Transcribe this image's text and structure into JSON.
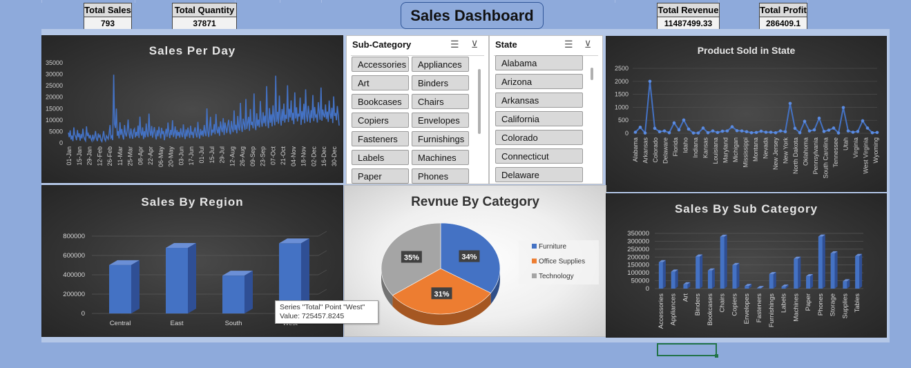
{
  "dashboard": {
    "title": "Sales Dashboard"
  },
  "kpis": {
    "total_sales": {
      "label": "Total Sales",
      "value": "793"
    },
    "total_quantity": {
      "label": "Total Quantity",
      "value": "37871"
    },
    "total_revenue": {
      "label": "Total Revenue",
      "value": "11487499.33"
    },
    "total_profit": {
      "label": "Total Profit",
      "value": "286409.1"
    }
  },
  "slicers": {
    "subcategory": {
      "header": "Sub-Category",
      "items": [
        "Accessories",
        "Appliances",
        "Art",
        "Binders",
        "Bookcases",
        "Chairs",
        "Copiers",
        "Envelopes",
        "Fasteners",
        "Furnishings",
        "Labels",
        "Machines",
        "Paper",
        "Phones"
      ]
    },
    "state": {
      "header": "State",
      "items": [
        "Alabama",
        "Arizona",
        "Arkansas",
        "California",
        "Colorado",
        "Connecticut",
        "Delaware"
      ]
    }
  },
  "tooltip": {
    "line1": "Series \"Total\" Point \"West\"",
    "line2": "Value: 725457.8245"
  },
  "chart_data": [
    {
      "id": "sales-per-day",
      "type": "line",
      "title": "Sales Per Day",
      "color": "#4472c4",
      "ylim": [
        0,
        35000
      ],
      "yticks": [
        "35000",
        "30000",
        "25000",
        "20000",
        "15000",
        "10000",
        "5000",
        "0"
      ],
      "xticks": [
        "01-Jan",
        "15-Jan",
        "29-Jan",
        "12-Feb",
        "26-Feb",
        "11-Mar",
        "25-Mar",
        "08-Apr",
        "22-Apr",
        "06-May",
        "20-May",
        "03-Jun",
        "17-Jun",
        "01-Jul",
        "15-Jul",
        "29-Jul",
        "12-Aug",
        "26-Aug",
        "09-Sep",
        "23-Sep",
        "07-Oct",
        "21-Oct",
        "04-Nov",
        "18-Nov",
        "02-Dec",
        "16-Dec",
        "30-Dec"
      ],
      "values": [
        4500,
        2500,
        5500,
        1500,
        3200,
        800,
        6800,
        3600,
        2800,
        1200,
        5600,
        2500,
        4200,
        1000,
        3800,
        2000,
        6200,
        2800,
        1600,
        900,
        7200,
        3000,
        4000,
        2000,
        3500,
        1800,
        900,
        3600,
        1400,
        2500,
        5200,
        1900,
        800,
        4100,
        2600,
        3300,
        1200,
        600,
        2900,
        5200,
        1800,
        900,
        3100,
        2400,
        1700,
        4200,
        7800,
        2200,
        3000,
        1200,
        29800,
        8200,
        6500,
        15000,
        3100,
        5200,
        2000,
        9000,
        3500,
        6100,
        3000,
        1500,
        7800,
        4200,
        2800,
        5600,
        10200,
        4100,
        2000,
        6300,
        3500,
        1800,
        5500,
        6200,
        2400,
        4800,
        3000,
        7600,
        2200,
        11500,
        4600,
        3200,
        6800,
        1700,
        5200,
        2400,
        8500,
        3900,
        2600,
        12800,
        5200,
        3100,
        7400,
        2300,
        4800,
        6900,
        3400,
        1500,
        5600,
        2900,
        7100,
        4100,
        2000,
        6600,
        3800,
        5200,
        1200,
        3900,
        6200,
        2700,
        8900,
        4500,
        2100,
        5700,
        3400,
        9900,
        2600,
        4200,
        7200,
        1800,
        5600,
        3100,
        4800,
        2300,
        6400,
        3900,
        2500,
        8100,
        3700,
        1700,
        5900,
        2800,
        6700,
        4300,
        2200,
        7500,
        3500,
        4900,
        2100,
        5300,
        6800,
        3600,
        2400,
        9200,
        4100,
        1900,
        6100,
        3300,
        5400,
        2800,
        7800,
        4400,
        3000,
        15100,
        5200,
        2600,
        6900,
        11400,
        3200,
        5800,
        4500,
        8200,
        3800,
        12600,
        5900,
        4200,
        7100,
        3100,
        9400,
        6200,
        4700,
        10800,
        3500,
        8900,
        6600,
        4300,
        7700,
        10100,
        5200,
        3800,
        9600,
        6300,
        4700,
        14200,
        5600,
        7900,
        4200,
        11800,
        6900,
        5400,
        17500,
        7200,
        4800,
        10600,
        8300,
        5700,
        19200,
        6100,
        8700,
        11400,
        5300,
        14800,
        7800,
        9200,
        6400,
        21600,
        8100,
        5600,
        12900,
        7400,
        10200,
        6800,
        18300,
        9600,
        7100,
        13400,
        8600,
        11900,
        7300,
        24800,
        9900,
        6500,
        15200,
        8800,
        12500,
        7200,
        16400,
        10300,
        7700,
        29400,
        9200,
        13600,
        8400,
        20700,
        11200,
        7600,
        14800,
        9700,
        17200,
        8900,
        12300,
        10500,
        25200,
        9100,
        14900,
        11100,
        18600,
        9800,
        13200,
        8200,
        22100,
        10700,
        15600,
        9400,
        12800,
        11600,
        19800,
        7900,
        13900,
        10200,
        17100,
        8600,
        23400,
        11900,
        9300,
        16200,
        12600,
        8800,
        14300,
        10800,
        20900,
        9500,
        15700,
        11400,
        12100,
        8900,
        17800,
        13300,
        10100,
        24200,
        9700,
        14600,
        12200,
        11200,
        16800,
        10400,
        13700,
        9200,
        18500,
        12900,
        10600,
        15400,
        8700,
        20300,
        11800,
        13100,
        9900,
        16100,
        12400,
        7600
      ]
    },
    {
      "id": "product-sold-in-state",
      "type": "line",
      "title": "Product Sold in State",
      "color": "#4472c4",
      "ylim": [
        0,
        2500
      ],
      "yticks": [
        "2500",
        "2000",
        "1500",
        "1000",
        "500",
        "0"
      ],
      "categories": [
        "Alabama",
        "Arkansas",
        "Colorado",
        "Delaware",
        "Florida",
        "Idaho",
        "Indiana",
        "Kansas",
        "Louisiana",
        "Maryland",
        "Michigan",
        "Mississippi",
        "Montana",
        "Nevada",
        "New Jersey",
        "New York",
        "North Dakota",
        "Oklahoma",
        "Pennsylvania",
        "South Carolina",
        "Tennessee",
        "Utah",
        "Virginia",
        "West Virginia",
        "Wyoming"
      ],
      "values": [
        40,
        230,
        10,
        2000,
        190,
        60,
        90,
        20,
        400,
        130,
        510,
        160,
        10,
        10,
        200,
        20,
        90,
        30,
        80,
        90,
        250,
        100,
        90,
        60,
        20,
        30,
        80,
        40,
        40,
        20,
        90,
        60,
        1150,
        190,
        20,
        460,
        90,
        130,
        580,
        70,
        120,
        200,
        10,
        990,
        90,
        40,
        70,
        480,
        200,
        20,
        30
      ]
    },
    {
      "id": "sales-by-region",
      "type": "bar",
      "title": "Sales By Region",
      "color": "#4472c4",
      "ylim": [
        0,
        800000
      ],
      "yticks": [
        "800000",
        "600000",
        "400000",
        "200000",
        "0"
      ],
      "categories": [
        "Central",
        "East",
        "South",
        "West"
      ],
      "values": [
        501239.89,
        678781.24,
        391721.91,
        725457.82
      ]
    },
    {
      "id": "revenue-by-category",
      "type": "pie",
      "title": "Revnue By Category",
      "labels": [
        "Furniture",
        "Office Supplies",
        "Technology"
      ],
      "values": [
        34,
        31,
        35
      ],
      "value_labels": [
        "34%",
        "31%",
        "35%"
      ],
      "colors": [
        "#4472c4",
        "#ed7d31",
        "#a5a5a5"
      ],
      "legend": "right"
    },
    {
      "id": "sales-by-sub-category",
      "type": "bar",
      "title": "Sales By Sub Category",
      "color": "#4472c4",
      "ylim": [
        0,
        350000
      ],
      "yticks": [
        "350000",
        "300000",
        "250000",
        "200000",
        "150000",
        "100000",
        "50000",
        "0"
      ],
      "categories": [
        "Accessories",
        "Appliances",
        "Art",
        "Binders",
        "Bookcases",
        "Chairs",
        "Copiers",
        "Envelopes",
        "Fasteners",
        "Furnishings",
        "Labels",
        "Machines",
        "Paper",
        "Phones",
        "Storage",
        "Supplies",
        "Tables"
      ],
      "values": [
        167380,
        107532,
        27119,
        203413,
        114880,
        328449,
        149528,
        16476,
        3024,
        91705,
        12486,
        189239,
        78479,
        330007,
        223844,
        46674,
        206966
      ]
    }
  ]
}
